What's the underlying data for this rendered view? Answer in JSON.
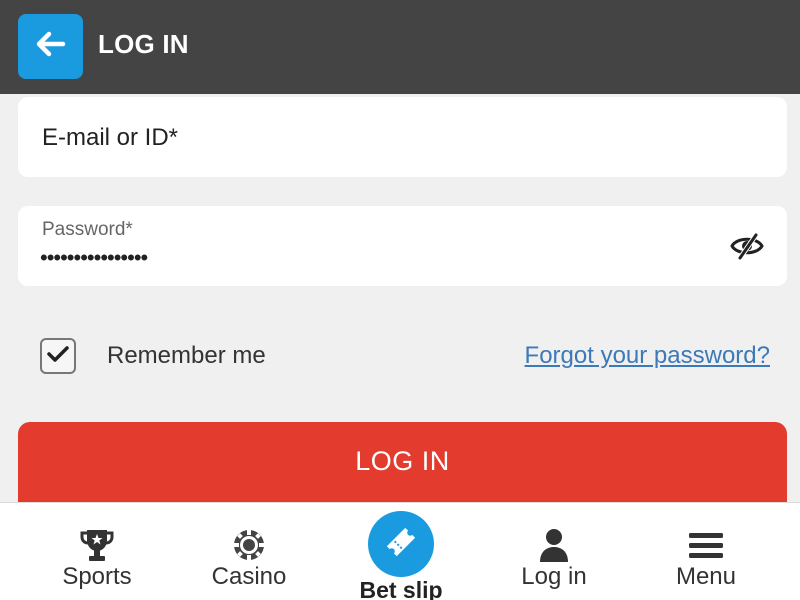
{
  "header": {
    "title": "LOG IN",
    "back_icon": "arrow-left-icon"
  },
  "form": {
    "email_placeholder": "E-mail or ID*",
    "password_label": "Password*",
    "password_value": "••••••••••••••••",
    "password_toggle_icon": "eye-slash-icon",
    "remember_label": "Remember me",
    "remember_checked": true,
    "forgot_link": "Forgot your password?",
    "login_button": "LOG IN"
  },
  "bottom_nav": {
    "items": [
      {
        "label": "Sports",
        "icon": "trophy-icon"
      },
      {
        "label": "Casino",
        "icon": "casino-chip-icon"
      },
      {
        "label": "Bet slip",
        "icon": "ticket-icon"
      },
      {
        "label": "Log in",
        "icon": "user-icon"
      },
      {
        "label": "Menu",
        "icon": "hamburger-menu-icon"
      }
    ]
  },
  "colors": {
    "header_bg": "#444444",
    "accent_blue": "#1a9be0",
    "login_red": "#e33b2e",
    "link_blue": "#3b79b8",
    "page_bg": "#f0f0f0"
  }
}
